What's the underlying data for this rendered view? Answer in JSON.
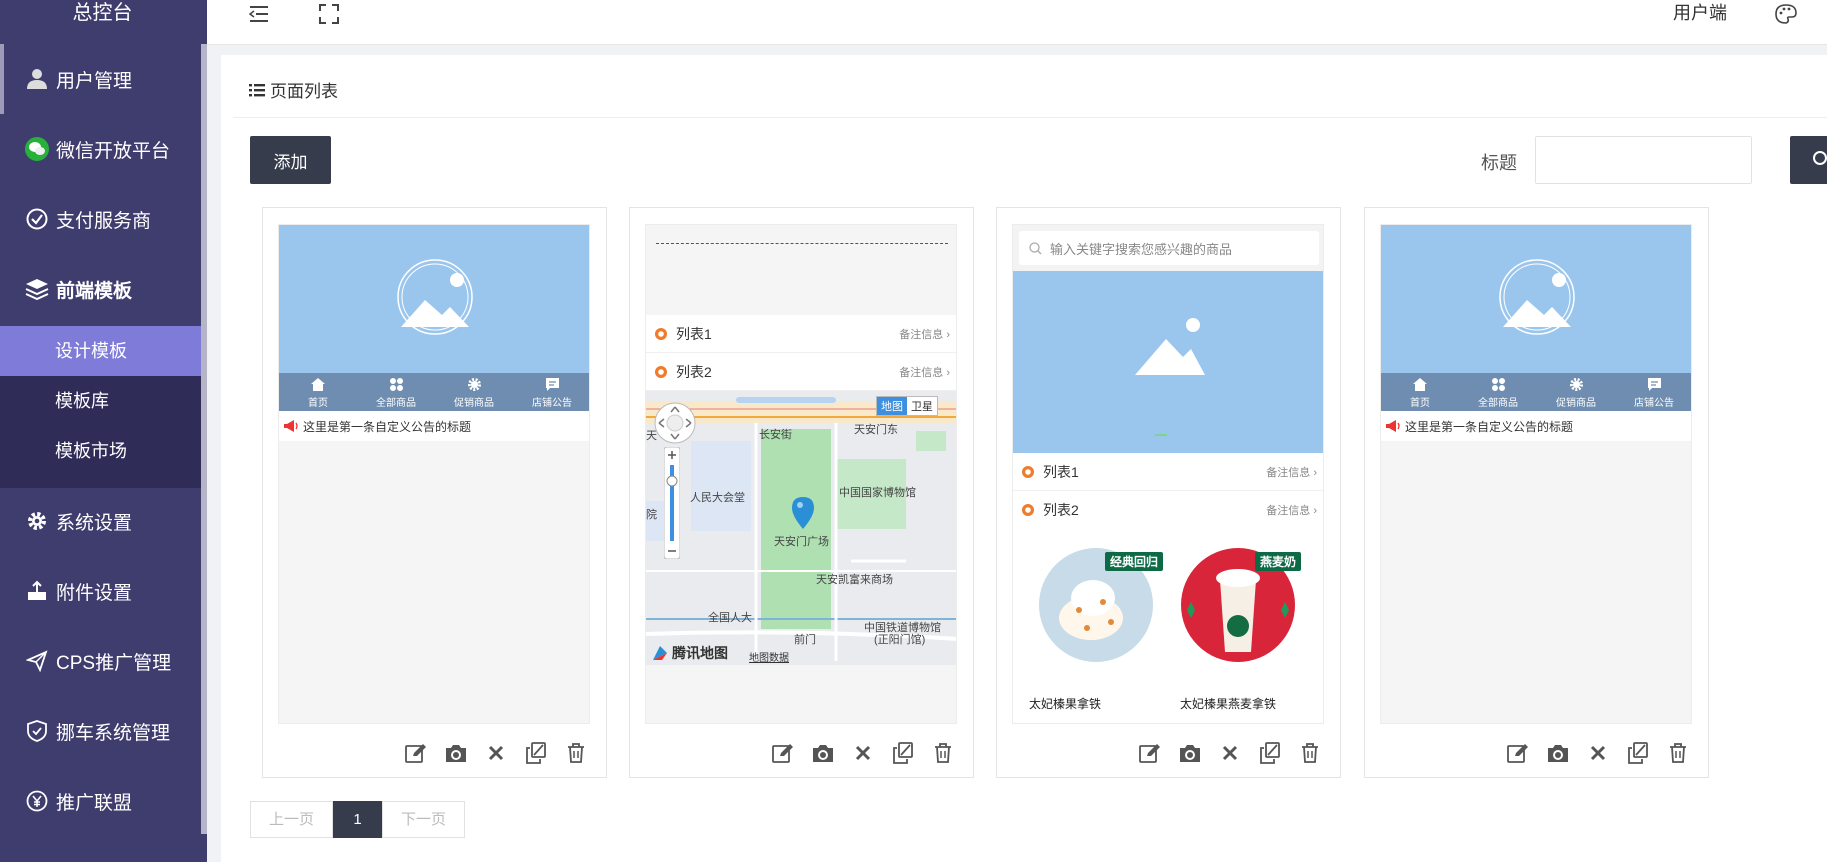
{
  "sidebar": {
    "brand": "总控台",
    "items": [
      {
        "label": "用户管理",
        "icon": "user-icon"
      },
      {
        "label": "微信开放平台",
        "icon": "wechat-icon"
      },
      {
        "label": "支付服务商",
        "icon": "check-circle-icon"
      },
      {
        "label": "前端模板",
        "icon": "layers-icon"
      },
      {
        "label": "系统设置",
        "icon": "gear-icon"
      },
      {
        "label": "附件设置",
        "icon": "upload-icon"
      },
      {
        "label": "CPS推广管理",
        "icon": "paper-plane-icon"
      },
      {
        "label": "挪车系统管理",
        "icon": "shield-check-icon"
      },
      {
        "label": "推广联盟",
        "icon": "yen-icon"
      }
    ],
    "subitems": [
      {
        "label": "设计模板",
        "active": true
      },
      {
        "label": "模板库"
      },
      {
        "label": "模板市场"
      }
    ]
  },
  "header": {
    "user_end": "用户端"
  },
  "panel": {
    "title": "页面列表",
    "add_label": "添加",
    "filter_label": "标题",
    "filter_value": ""
  },
  "cards": {
    "nav": [
      "首页",
      "全部商品",
      "促销商品",
      "店铺公告"
    ],
    "notice": "这里是第一条自定义公告的标题",
    "list1": "列表1",
    "list2": "列表2",
    "note": "备注信息",
    "map": {
      "btn_map": "地图",
      "btn_sat": "卫星",
      "logo": "腾讯地图",
      "data": "地图数据",
      "labels": [
        "长安街",
        "天安门东",
        "人民大会堂",
        "中国国家博物馆",
        "天安门广场",
        "天安凯富来商场",
        "全国人大",
        "前门",
        "中国铁道博物馆",
        "(正阳门馆)",
        "天",
        "院"
      ]
    },
    "search_placeholder": "输入关键字搜索您感兴趣的商品",
    "goods": [
      {
        "name": "太妃榛果拿铁",
        "tag": "经典回归"
      },
      {
        "name": "太妃榛果燕麦拿铁",
        "tag": "燕麦奶"
      }
    ]
  },
  "pagination": {
    "prev": "上一页",
    "current": "1",
    "next": "下一页"
  }
}
